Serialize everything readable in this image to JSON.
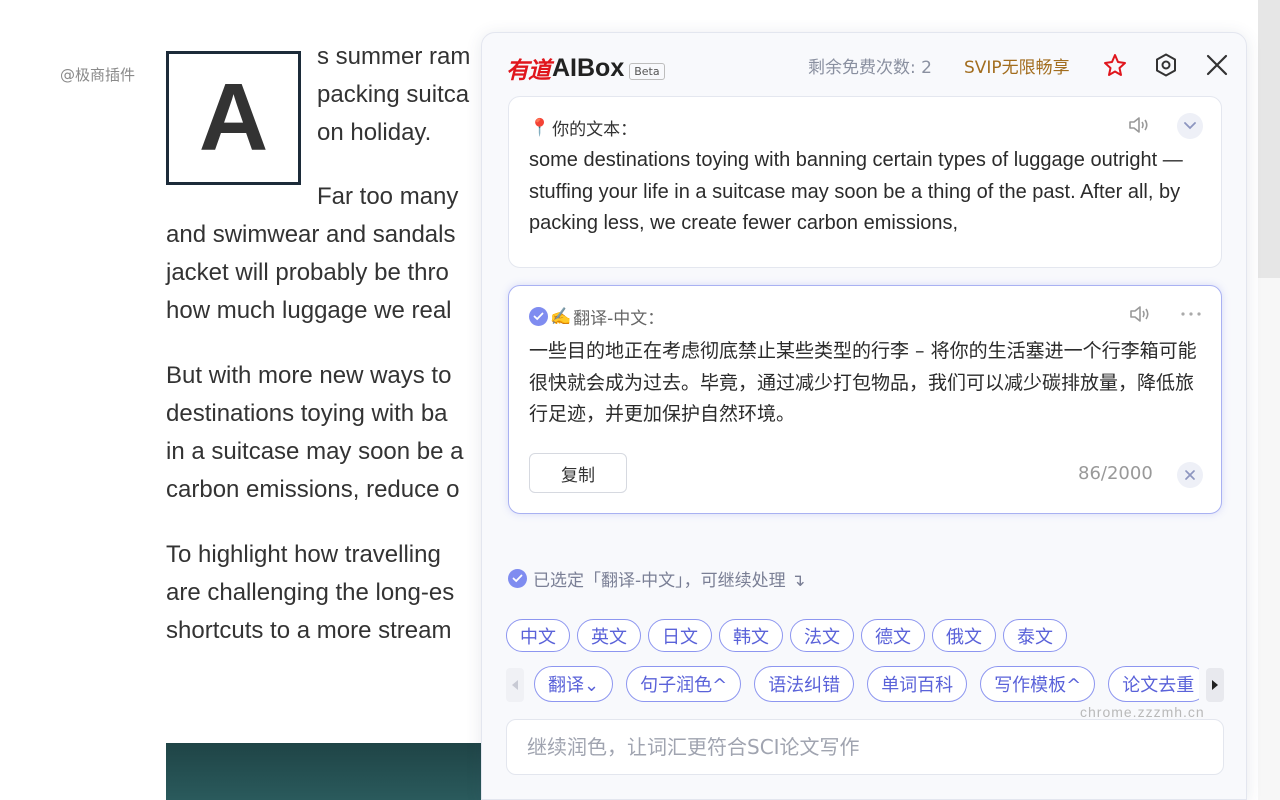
{
  "article": {
    "watermark": "@极商插件",
    "dropcap": "A",
    "lines": [
      "s summer ram",
      "packing suitca",
      "on holiday.",
      "Far too many",
      "and swimwear and sandals",
      "jacket will probably be thro",
      "how much luggage we real",
      "But with more new ways to",
      "destinations toying with ba",
      "in a suitcase may soon be a",
      "carbon emissions, reduce o",
      "To highlight how travelling",
      "are challenging the long-es",
      "shortcuts to a more stream"
    ]
  },
  "panel": {
    "logo_cn": "有道",
    "logo_en": "AIBox",
    "beta": "Beta",
    "remaining": "剩余免费次数: 2",
    "svip": "SVIP无限畅享",
    "icons": {
      "pin": "pin-icon",
      "settings": "settings-hexagon-icon",
      "close": "close-icon"
    },
    "source": {
      "pin_emoji": "📍",
      "title": "你的文本：",
      "text": "some destinations toying with banning certain types of luggage outright — stuffing your life in a suitcase may soon be a thing of the past. After all, by packing less, we create fewer carbon emissions,"
    },
    "translation": {
      "emoji": "✍️",
      "title": "翻译-中文：",
      "text": "一些目的地正在考虑彻底禁止某些类型的行李 – 将你的生活塞进一个行李箱可能很快就会成为过去。毕竟，通过减少打包物品，我们可以减少碳排放量，降低旅行足迹，并更加保护自然环境。",
      "copy": "复制",
      "counter": "86/2000"
    },
    "status": "已选定「翻译-中文」，可继续处理 ↴",
    "languages": [
      "中文",
      "英文",
      "日文",
      "韩文",
      "法文",
      "德文",
      "俄文",
      "泰文"
    ],
    "functions": [
      "翻译⌄",
      "句子润色^",
      "语法纠错",
      "单词百科",
      "写作模板^",
      "论文去重"
    ],
    "input_placeholder": "继续润色，让词汇更符合SCI论文写作",
    "site_watermark": "chrome.zzzmh.cn",
    "accent": "#5a62d9",
    "brand_red": "#e0161d"
  }
}
